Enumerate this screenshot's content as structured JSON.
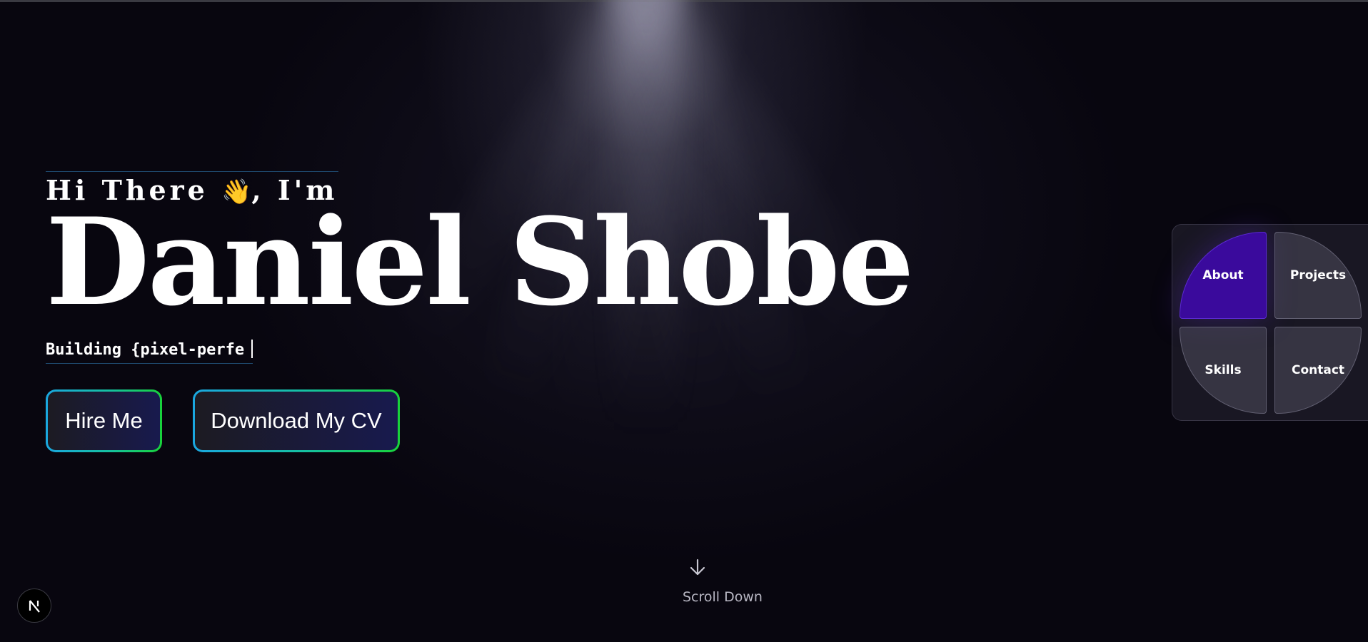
{
  "hero": {
    "greeting_prefix": "Hi There ",
    "greeting_emoji": "👋",
    "greeting_suffix": ", I'm",
    "name": "Daniel Shobe",
    "typing_text": "Building {pixel-perfe"
  },
  "actions": {
    "hire_label": "Hire Me",
    "cv_label": "Download My CV"
  },
  "quad_nav": {
    "about": "About",
    "projects": "Projects",
    "skills": "Skills",
    "contact": "Contact"
  },
  "scroll": {
    "label": "Scroll Down",
    "icon": "arrow-down-icon"
  },
  "badge": {
    "icon": "nextjs-logo-icon"
  },
  "colors": {
    "background": "#08060f",
    "about_active": "#3a0a9c",
    "button_gradient_start": "#1aa7e0",
    "button_gradient_end": "#18d23a"
  }
}
